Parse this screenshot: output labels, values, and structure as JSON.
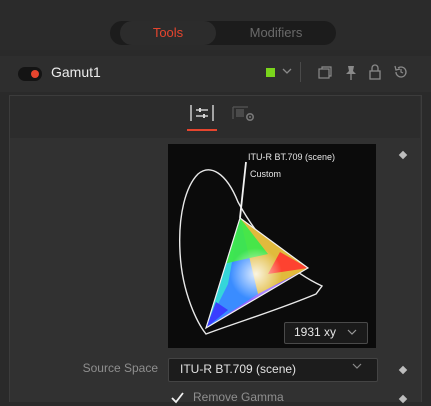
{
  "tabs": {
    "tools": "Tools",
    "modifiers": "Modifiers"
  },
  "node": {
    "name": "Gamut1",
    "color_swatch": "#7ad51c"
  },
  "header_icons": [
    "chevron-down-icon",
    "window-icon",
    "pin-icon",
    "lock-icon",
    "reset-icon"
  ],
  "panel_tabs": [
    "controls-tab",
    "settings-tab"
  ],
  "chart": {
    "label_space": "ITU-R BT.709 (scene)",
    "label_custom": "Custom",
    "diagram_select": "1931 xy"
  },
  "source_space": {
    "label": "Source Space",
    "value": "ITU-R BT.709 (scene)"
  },
  "remove_gamma": {
    "label": "Remove Gamma",
    "checked": true
  },
  "colors": {
    "accent": "#e6452e",
    "background": "#2a2a2a"
  }
}
